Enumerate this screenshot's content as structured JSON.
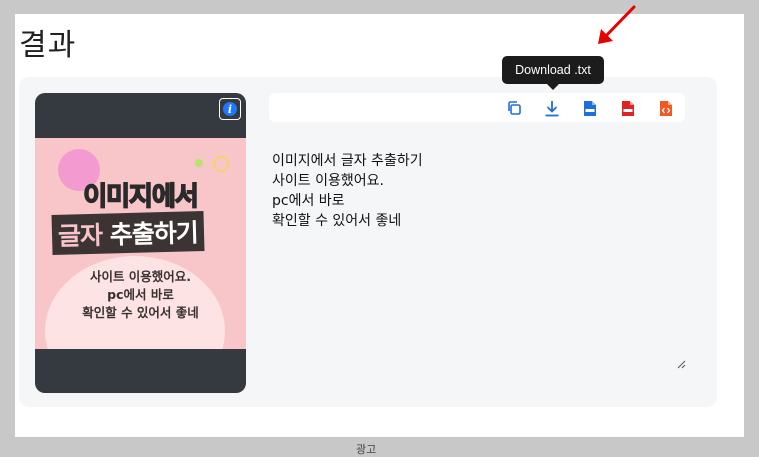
{
  "section": {
    "title": "결과"
  },
  "preview": {
    "info_label": "i",
    "image_lines": {
      "title_top": "이미지에서",
      "title_bottom_a": "글자",
      "title_bottom_b": "추출하기",
      "sub_1": "사이트 이용했어요.",
      "sub_2": "pc에서 바로",
      "sub_3": "확인할 수 있어서 좋네"
    }
  },
  "toolbar": {
    "tools": [
      {
        "icon": "copy-icon",
        "color": "#1e6fd9"
      },
      {
        "icon": "download-icon",
        "color": "#1e6fd9"
      },
      {
        "icon": "doc-file-icon",
        "color": "#1e6fd9"
      },
      {
        "icon": "pdf-file-icon",
        "color": "#e02424"
      },
      {
        "icon": "html-file-icon",
        "color": "#f05a22"
      }
    ],
    "tooltip": "Download .txt"
  },
  "result_text": "이미지에서 글자 추출하기\n사이트 이용했어요.\npc에서 바로\n확인할 수 있어서 좋네",
  "footer": {
    "ad_label": "광고"
  },
  "colors": {
    "accent": "#1e6fd9",
    "annotation_arrow": "#e60000"
  }
}
